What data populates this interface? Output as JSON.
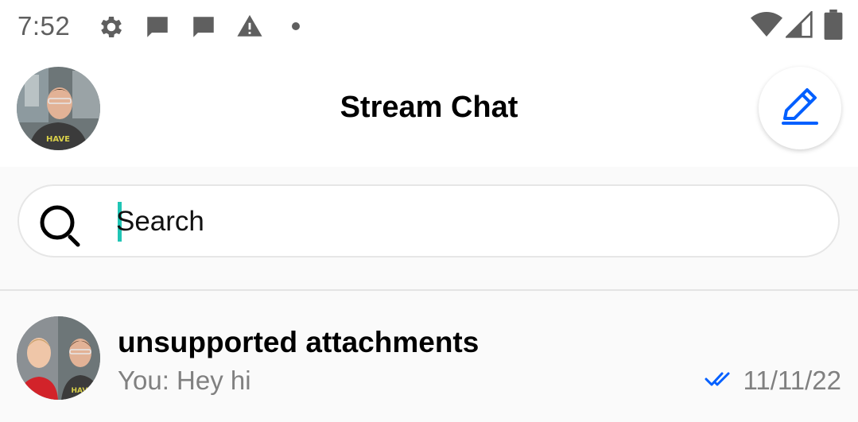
{
  "status_bar": {
    "time": "7:52",
    "left_icons": [
      "gear-icon",
      "message-icon",
      "message-icon",
      "warning-icon",
      "dot-icon"
    ],
    "right_icons": [
      "wifi-icon",
      "signal-icon",
      "battery-icon"
    ]
  },
  "header": {
    "title": "Stream Chat",
    "avatar": "user-avatar",
    "compose_icon": "pencil-icon"
  },
  "search": {
    "placeholder": "Search",
    "value": ""
  },
  "channels": [
    {
      "name": "unsupported attachments",
      "last_message": "You: Hey hi",
      "date": "11/11/22",
      "read_status_icon": "double-check-icon"
    }
  ],
  "colors": {
    "accent": "#005fff",
    "caret": "#20c5b5",
    "muted_text": "#808080"
  }
}
